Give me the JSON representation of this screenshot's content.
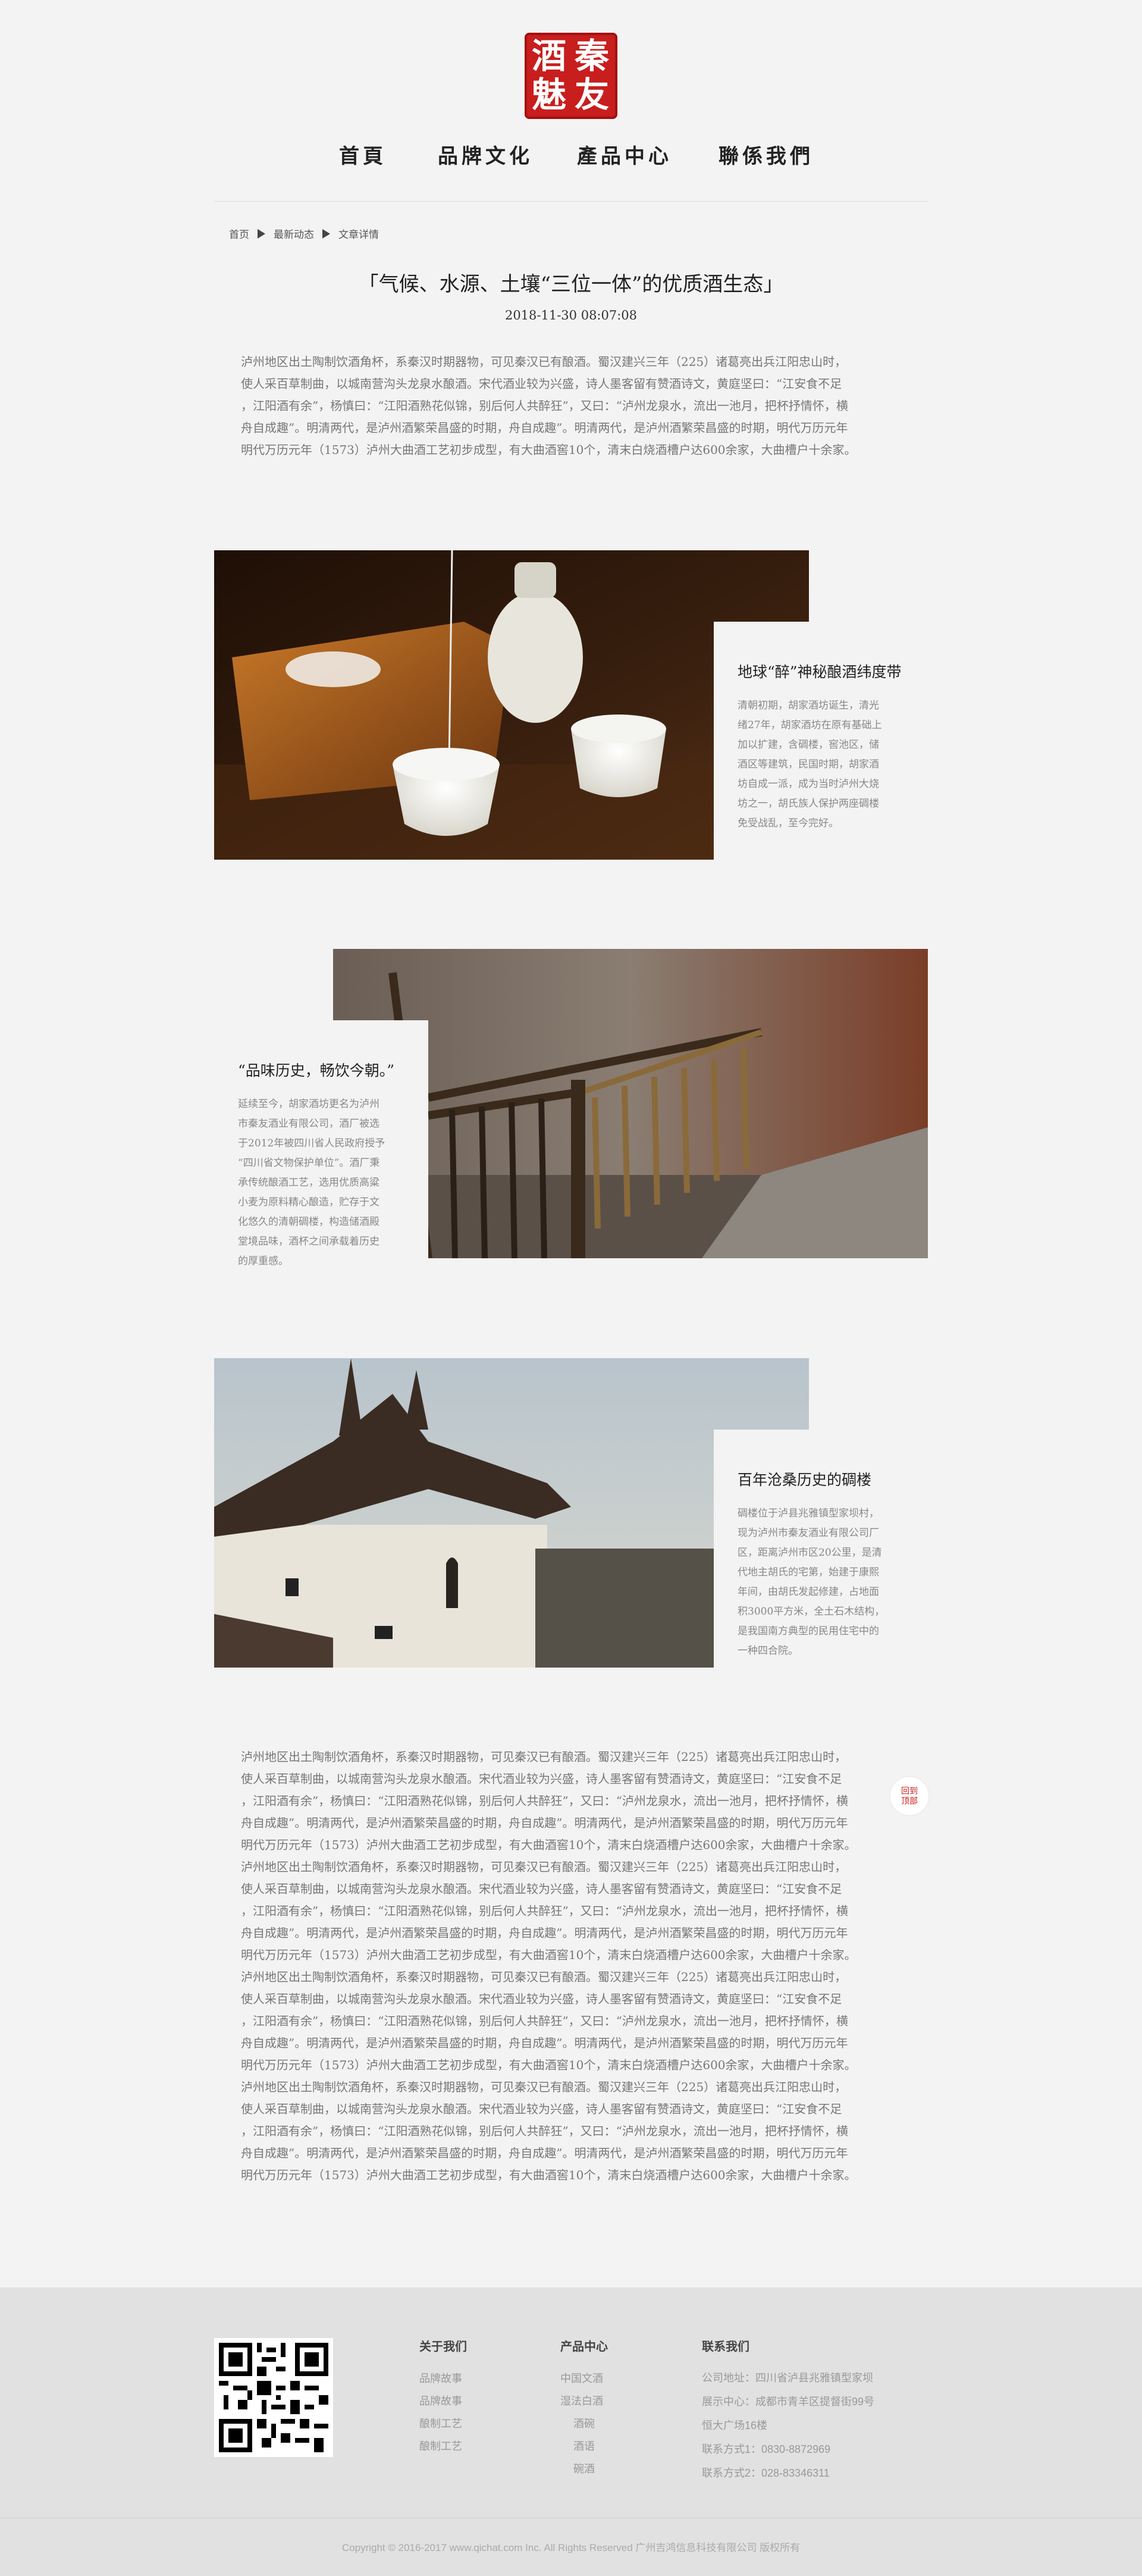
{
  "logo": {
    "chars": [
      "秦",
      "友",
      "酒",
      "魅"
    ]
  },
  "nav": {
    "items": [
      "首頁",
      "品牌文化",
      "產品中心",
      "聯係我們"
    ]
  },
  "breadcrumb": {
    "items": [
      "首页",
      "最新动态",
      "文章详情"
    ]
  },
  "article": {
    "title": "「气候、水源、土壤“三位一体”的优质酒生态」",
    "date": "2018-11-30  08:07:08",
    "intro": [
      "泸州地区出土陶制饮酒角杯，系秦汉时期器物，可见秦汉已有酿酒。蜀汉建兴三年（225）诸葛亮出兵江阳忠山时，",
      "使人采百草制曲，以城南营沟头龙泉水酿酒。宋代酒业较为兴盛，诗人墨客留有赞酒诗文，黄庭坚曰：“江安食不足",
      "，江阳酒有余”，杨慎曰：“江阳酒熟花似锦，别后何人共醉狂”，又曰：“泸州龙泉水，流出一池月，把杯抒情怀，横",
      "舟自成趣”。明清两代，是泸州酒繁荣昌盛的时期，舟自成趣”。明清两代，是泸州酒繁荣昌盛的时期，明代万历元年",
      "明代万历元年（1573）泸州大曲酒工艺初步成型，有大曲酒窖10个，清末白烧酒槽户达600余家，大曲槽户十余家。"
    ]
  },
  "sections": [
    {
      "title": "地球“醉”神秘酿酒纬度带",
      "text": [
        "清朝初期，胡家酒坊诞生，清光",
        "绪27年，胡家酒坊在原有基础上",
        "加以扩建，含碉楼，窖池区，储",
        "酒区等建筑，民国时期，胡家酒",
        "坊自成一派，成为当时泸州大烧",
        "坊之一，胡氏族人保护两座碉楼",
        "免受战乱，至今完好。"
      ]
    },
    {
      "title": "“品味历史，畅饮今朝。”",
      "text": [
        "延续至今，胡家酒坊更名为泸州",
        "市秦友酒业有限公司，酒厂被选",
        "于2012年被四川省人民政府授予",
        "“四川省文物保护单位”。酒厂秉",
        "承传统酿酒工艺，选用优质高粱",
        "小麦为原料精心酿造，贮存于文",
        "化悠久的清朝碉楼，构造储酒殿",
        "堂境品味，酒杯之间承载着历史",
        "的厚重感。"
      ]
    },
    {
      "title": "百年沧桑历史的碉楼",
      "text": [
        "碉楼位于泸县兆雅镇型家坝村，",
        "现为泸州市秦友酒业有限公司厂",
        "区，距离泸州市区20公里，是清",
        "代地主胡氏的宅第，始建于康熙",
        "年间，由胡氏发起修建，占地面",
        "积3000平方米，全土石木结构，",
        "是我国南方典型的民用住宅中的",
        "一种四合院。"
      ]
    }
  ],
  "body_text": [
    "泸州地区出土陶制饮酒角杯，系秦汉时期器物，可见秦汉已有酿酒。蜀汉建兴三年（225）诸葛亮出兵江阳忠山时，",
    "使人采百草制曲，以城南营沟头龙泉水酿酒。宋代酒业较为兴盛，诗人墨客留有赞酒诗文，黄庭坚曰：“江安食不足",
    "，江阳酒有余”，杨慎曰：“江阳酒熟花似锦，别后何人共醉狂”，又曰：“泸州龙泉水，流出一池月，把杯抒情怀，横",
    "舟自成趣”。明清两代，是泸州酒繁荣昌盛的时期，舟自成趣”。明清两代，是泸州酒繁荣昌盛的时期，明代万历元年",
    "明代万历元年（1573）泸州大曲酒工艺初步成型，有大曲酒窖10个，清末白烧酒槽户达600余家，大曲槽户十余家。",
    "泸州地区出土陶制饮酒角杯，系秦汉时期器物，可见秦汉已有酿酒。蜀汉建兴三年（225）诸葛亮出兵江阳忠山时，",
    "使人采百草制曲，以城南营沟头龙泉水酿酒。宋代酒业较为兴盛，诗人墨客留有赞酒诗文，黄庭坚曰：“江安食不足",
    "，江阳酒有余”，杨慎曰：“江阳酒熟花似锦，别后何人共醉狂”，又曰：“泸州龙泉水，流出一池月，把杯抒情怀，横",
    "舟自成趣”。明清两代，是泸州酒繁荣昌盛的时期，舟自成趣”。明清两代，是泸州酒繁荣昌盛的时期，明代万历元年",
    "明代万历元年（1573）泸州大曲酒工艺初步成型，有大曲酒窖10个，清末白烧酒槽户达600余家，大曲槽户十余家。",
    "泸州地区出土陶制饮酒角杯，系秦汉时期器物，可见秦汉已有酿酒。蜀汉建兴三年（225）诸葛亮出兵江阳忠山时，",
    "使人采百草制曲，以城南营沟头龙泉水酿酒。宋代酒业较为兴盛，诗人墨客留有赞酒诗文，黄庭坚曰：“江安食不足",
    "，江阳酒有余”，杨慎曰：“江阳酒熟花似锦，别后何人共醉狂”，又曰：“泸州龙泉水，流出一池月，把杯抒情怀，横",
    "舟自成趣”。明清两代，是泸州酒繁荣昌盛的时期，舟自成趣”。明清两代，是泸州酒繁荣昌盛的时期，明代万历元年",
    "明代万历元年（1573）泸州大曲酒工艺初步成型，有大曲酒窖10个，清末白烧酒槽户达600余家，大曲槽户十余家。",
    "泸州地区出土陶制饮酒角杯，系秦汉时期器物，可见秦汉已有酿酒。蜀汉建兴三年（225）诸葛亮出兵江阳忠山时，",
    "使人采百草制曲，以城南营沟头龙泉水酿酒。宋代酒业较为兴盛，诗人墨客留有赞酒诗文，黄庭坚曰：“江安食不足",
    "，江阳酒有余”，杨慎曰：“江阳酒熟花似锦，别后何人共醉狂”，又曰：“泸州龙泉水，流出一池月，把杯抒情怀，横",
    "舟自成趣”。明清两代，是泸州酒繁荣昌盛的时期，舟自成趣”。明清两代，是泸州酒繁荣昌盛的时期，明代万历元年",
    "明代万历元年（1573）泸州大曲酒工艺初步成型，有大曲酒窖10个，清末白烧酒槽户达600余家，大曲槽户十余家。"
  ],
  "back_to_top": {
    "line1": "回到",
    "line2": "顶部"
  },
  "footer": {
    "qr_caption": [
      "",
      ""
    ],
    "about": {
      "title": "关于我们",
      "items": [
        "品牌故事",
        "品牌故事",
        "酿制工艺",
        "酿制工艺"
      ]
    },
    "products": {
      "title": "产品中心",
      "items": [
        "中国文酒",
        "湿法白酒",
        "酒碗",
        "酒语",
        "碗酒"
      ]
    },
    "contact": {
      "title": "联系我们",
      "lines": [
        "公司地址：四川省泸县兆雅镇型家坝",
        "展示中心：成都市青羊区提督街99号",
        "恒大广场16楼",
        "联系方式1：0830-8872969",
        "联系方式2：028-83346311"
      ]
    },
    "copyright": "Copyright © 2016-2017 www.qichat.com Inc. All Rights Reserved 广州吉鸿信息科技有限公司 版权所有"
  },
  "colors": {
    "brand_red": "#c81e1e",
    "page_bg": "#f3f3f3",
    "footer_bg": "#e1e1e1"
  },
  "icons": [
    "seal-logo",
    "triangle-right-icon",
    "qr-code",
    "back-to-top-icon"
  ]
}
